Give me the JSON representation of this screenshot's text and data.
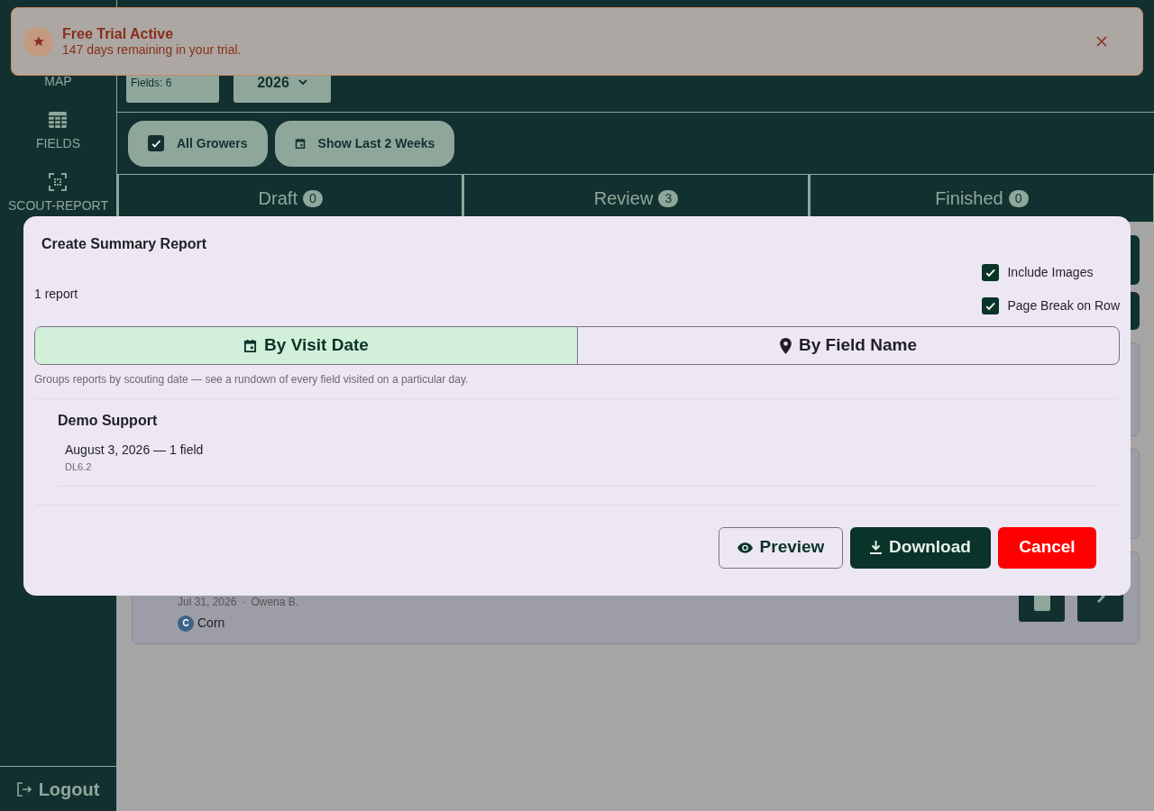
{
  "toast": {
    "title": "Free Trial Active",
    "message": "147 days remaining in your trial."
  },
  "sidebar": {
    "items": [
      {
        "label": "MAP",
        "kind": "map"
      },
      {
        "label": "FIELDS",
        "kind": "fields"
      },
      {
        "label": "SCOUT-REPORT",
        "kind": "scout"
      }
    ],
    "logout": "Logout"
  },
  "header": {
    "fields_count": "Fields: 6",
    "year": "2026"
  },
  "filters": [
    {
      "kind": "checkbox",
      "label": "All Growers",
      "checked": true
    },
    {
      "kind": "calendar",
      "label": "Show Last 2 Weeks"
    }
  ],
  "tabs": [
    {
      "label": "Draft",
      "count": "0"
    },
    {
      "label": "Review",
      "count": "3"
    },
    {
      "label": "Finished",
      "count": "0"
    }
  ],
  "background_card": {
    "date": "Jul 31, 2026",
    "separator": "·",
    "author": "Owena B.",
    "crop_badge": "C",
    "crop": "Corn"
  },
  "modal": {
    "title": "Create Summary Report",
    "count": "1 report",
    "options": [
      {
        "label": "Include Images",
        "checked": true
      },
      {
        "label": "Page Break on Row",
        "checked": true
      }
    ],
    "modes": [
      {
        "kind": "date",
        "label": "By Visit Date",
        "selected": true
      },
      {
        "kind": "field",
        "label": "By Field Name",
        "selected": false
      }
    ],
    "description": "Groups reports by scouting date — see a rundown of every field visited on a particular day.",
    "groups": [
      {
        "name": "Demo Support",
        "entries": [
          {
            "title": "August 3, 2026 — 1 field",
            "fields": "DL6.2"
          }
        ]
      }
    ],
    "buttons": [
      {
        "kind": "preview",
        "label": "Preview"
      },
      {
        "kind": "download",
        "label": "Download"
      },
      {
        "kind": "cancel",
        "label": "Cancel"
      }
    ]
  }
}
